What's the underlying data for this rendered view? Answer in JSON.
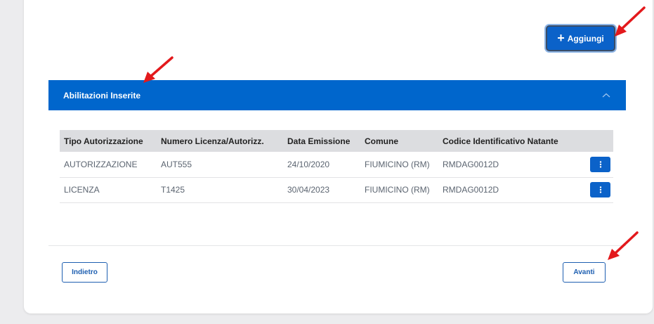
{
  "toolbar": {
    "add_label": "Aggiungi",
    "add_icon": "plus-icon"
  },
  "section": {
    "title": "Abilitazioni Inserite",
    "collapse_icon": "chevron-up-icon",
    "color": "#0066cc"
  },
  "table": {
    "headers": [
      "Tipo Autorizzazione",
      "Numero Licenza/Autorizz.",
      "Data Emissione",
      "Comune",
      "Codice Identificativo Natante"
    ],
    "rows": [
      [
        "AUTORIZZAZIONE",
        "AUT555",
        "24/10/2020",
        "FIUMICINO (RM)",
        "RMDAG0012D"
      ],
      [
        "LICENZA",
        "T1425",
        "30/04/2023",
        "FIUMICINO (RM)",
        "RMDAG0012D"
      ]
    ],
    "row_action_icon": "more-vertical-icon"
  },
  "footer": {
    "back_label": "Indietro",
    "next_label": "Avanti"
  },
  "annotations": {
    "arrow_color": "#e3191c",
    "arrow_icon": "red-arrow-icon"
  }
}
